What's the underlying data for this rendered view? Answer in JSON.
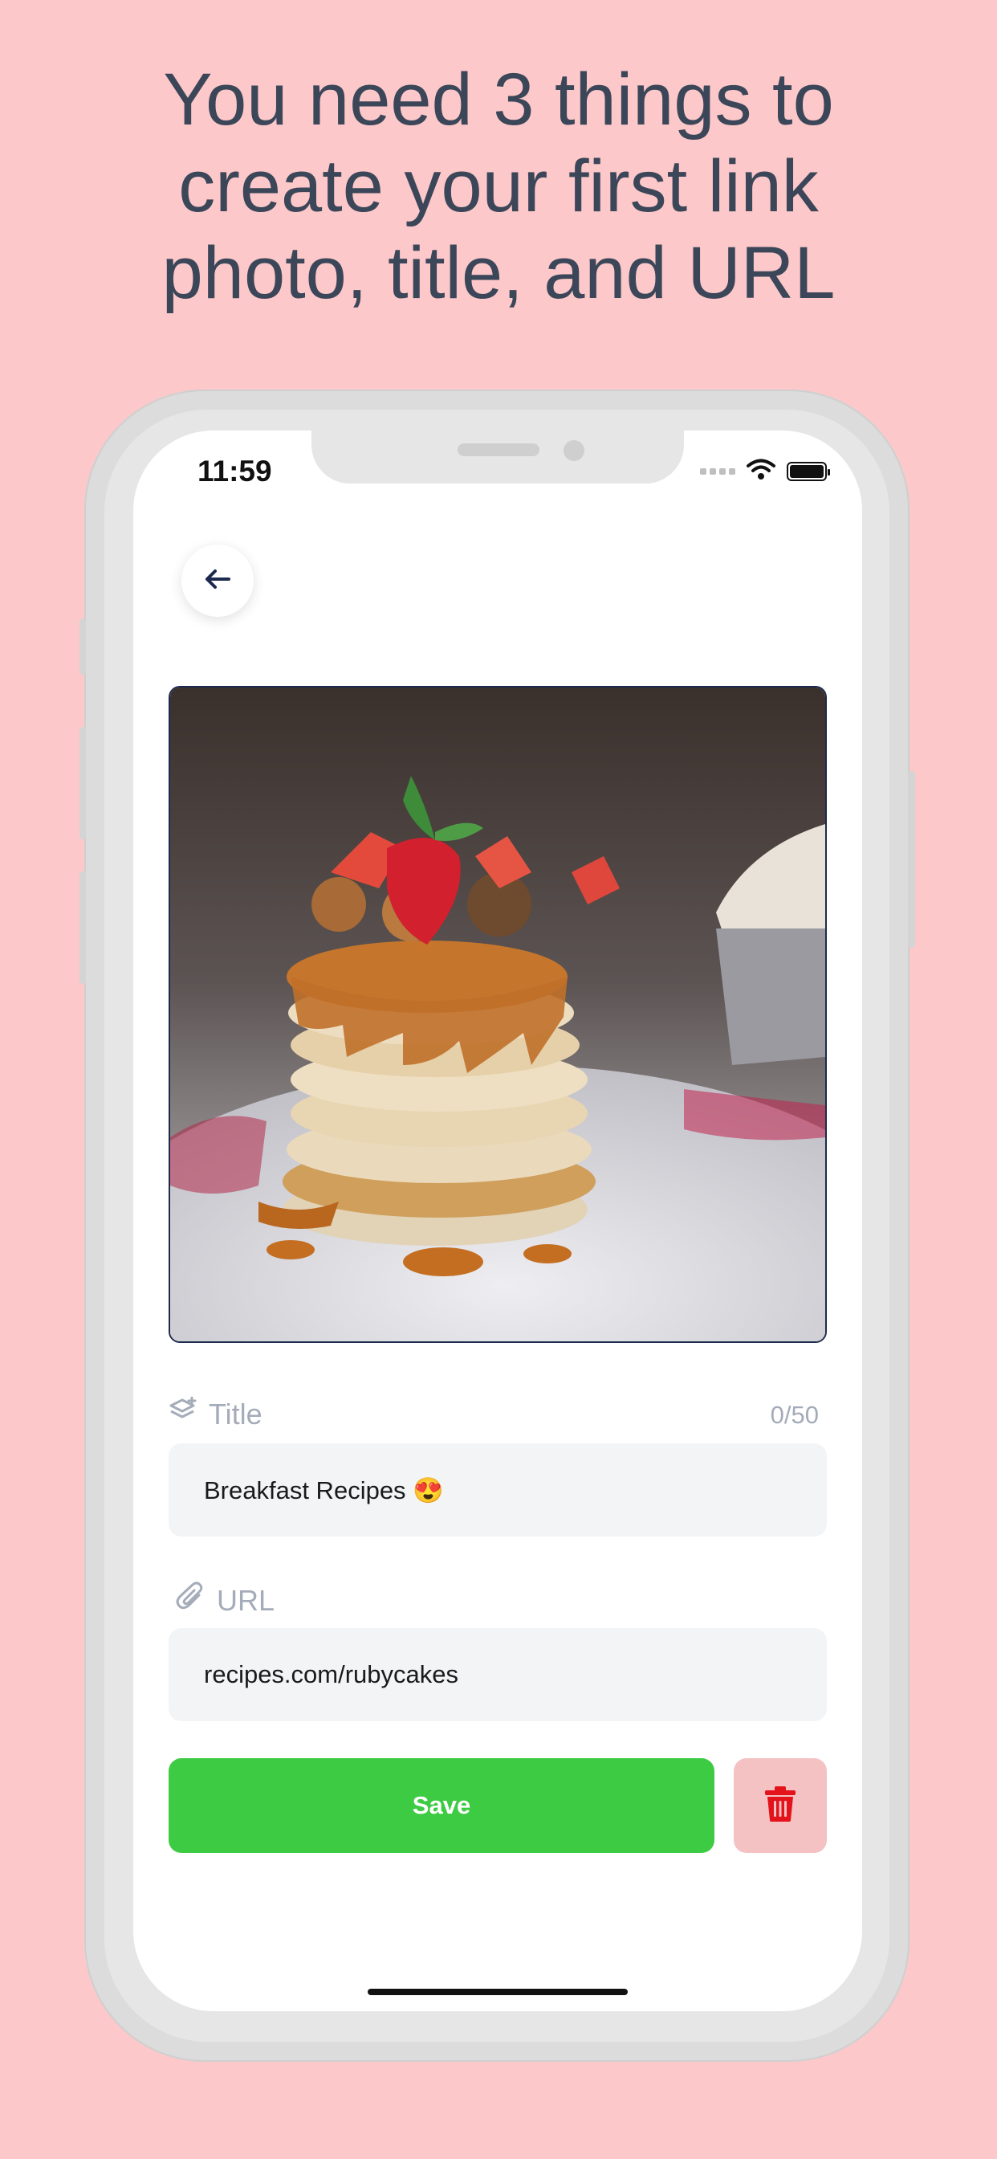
{
  "headline": {
    "line1": "You need 3 things to",
    "line2": "create your first link",
    "line3": "photo, title, and URL"
  },
  "status_bar": {
    "time": "11:59",
    "icons": [
      "signal-dots-icon",
      "wifi-icon",
      "battery-icon"
    ]
  },
  "nav": {
    "back_icon": "arrow-left-icon"
  },
  "photo": {
    "subject": "stack of pancakes with caramel and strawberries",
    "border_color": "#1d2a4d"
  },
  "title_field": {
    "label": "Title",
    "counter": "0/50",
    "value": "Breakfast Recipes 😍",
    "icon": "layers-plus-icon"
  },
  "url_field": {
    "label": "URL",
    "value": "recipes.com/rubycakes",
    "icon": "paperclip-icon"
  },
  "actions": {
    "save_label": "Save",
    "save_color": "#3ecb44",
    "delete_icon": "trash-icon",
    "delete_bg": "#f4c2c3",
    "delete_icon_color": "#e3121b"
  },
  "colors": {
    "page_bg": "#fcc8c9",
    "headline": "#3c4659",
    "label": "#a4acba",
    "input_bg": "#f3f4f6"
  }
}
